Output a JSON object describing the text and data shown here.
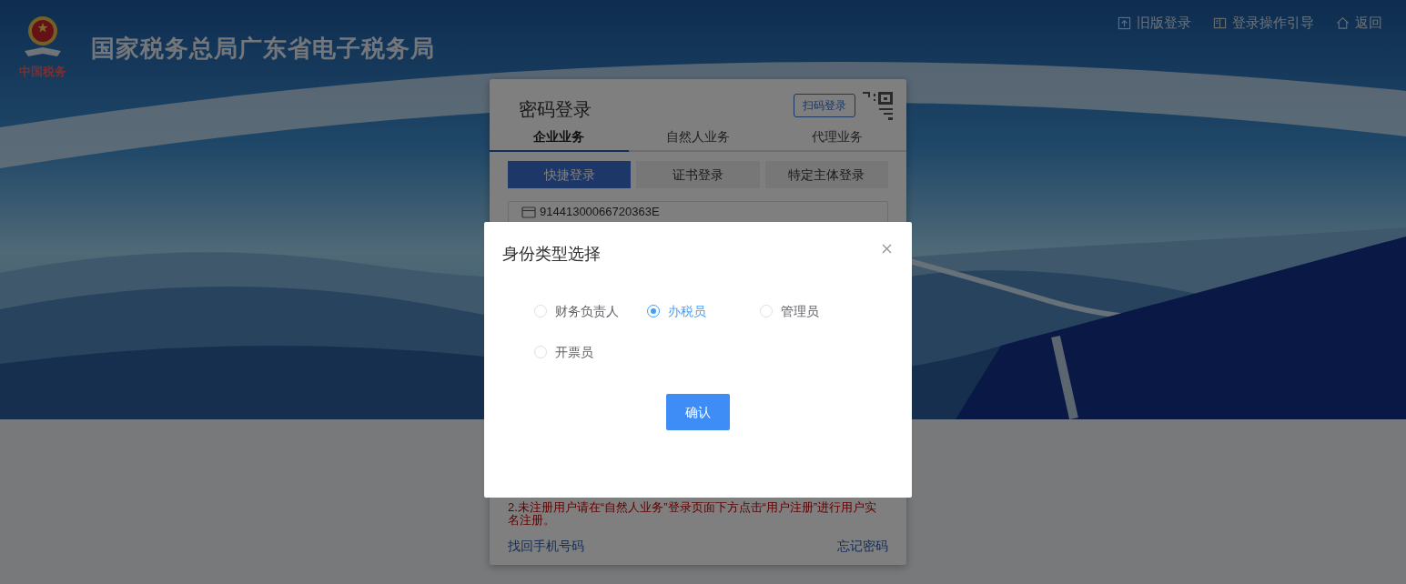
{
  "header": {
    "logo_caption": "中国税务",
    "title": "国家税务总局广东省电子税务局",
    "links": [
      {
        "kind": "upload",
        "label": "旧版登录"
      },
      {
        "kind": "book",
        "label": "登录操作引导"
      },
      {
        "kind": "home",
        "label": "返回"
      }
    ]
  },
  "login_panel": {
    "title": "密码登录",
    "qr_button": "扫码登录",
    "tabs": [
      {
        "label": "企业业务",
        "selected": true
      },
      {
        "label": "自然人业务",
        "selected": false
      },
      {
        "label": "代理业务",
        "selected": false
      }
    ],
    "methods": [
      {
        "label": "快捷登录",
        "selected": true
      },
      {
        "label": "证书登录",
        "selected": false
      },
      {
        "label": "特定主体登录",
        "selected": false
      }
    ],
    "account_field": {
      "value": "91441300066720363E"
    },
    "notice": "2.未注册用户请在“自然人业务”登录页面下方点击“用户注册”进行用户实名注册。",
    "links": [
      "找回手机号码",
      "忘记密码"
    ]
  },
  "dialog": {
    "title": "身份类型选择",
    "options": [
      {
        "label": "财务负责人",
        "selected": false
      },
      {
        "label": "办税员",
        "selected": true
      },
      {
        "label": "管理员",
        "selected": false
      },
      {
        "label": "开票员",
        "selected": false
      }
    ],
    "confirm": "确认"
  }
}
